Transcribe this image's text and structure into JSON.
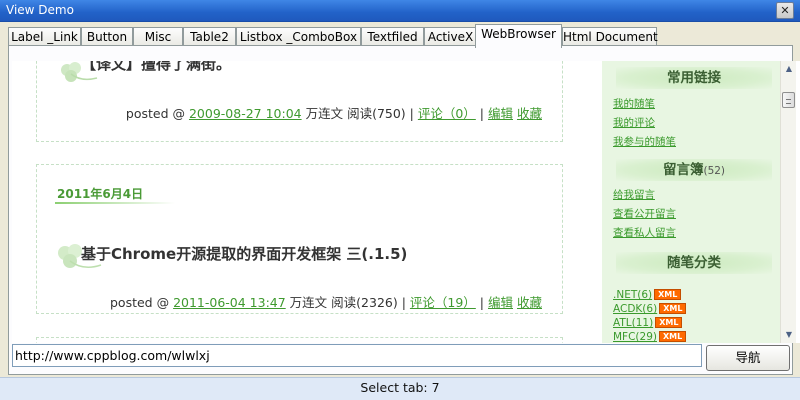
{
  "window": {
    "title": "View Demo",
    "close_glyph": "✕"
  },
  "tabs": [
    {
      "label": "Label _Link"
    },
    {
      "label": "Button"
    },
    {
      "label": "Misc"
    },
    {
      "label": "Table2"
    },
    {
      "label": "Listbox _ComboBox"
    },
    {
      "label": "Textfiled"
    },
    {
      "label": "ActiveX"
    },
    {
      "label": "WebBrowser"
    },
    {
      "label": "Html Document"
    }
  ],
  "active_tab_index": 7,
  "browser": {
    "posts": [
      {
        "title": "【译文】擅得了满街。",
        "meta_prefix": "posted @ ",
        "datetime": "2009-08-27 10:04",
        "author": " 万连文 ",
        "reads": "阅读(750)",
        "sep1": " | ",
        "comments": "评论（0）",
        "sep2": " | ",
        "edit": "编辑",
        "fav": "收藏"
      },
      {
        "date": "2011年6月4日",
        "title": "基于Chrome开源提取的界面开发框架 三(.1.5)",
        "meta_prefix": "posted @ ",
        "datetime": "2011-06-04 13:47",
        "author": " 万连文 ",
        "reads": "阅读(2326)",
        "sep1": " | ",
        "comments": "评论（19）",
        "sep2": " | ",
        "edit": "编辑",
        "fav": "收藏"
      }
    ],
    "sidebar": {
      "links_title": "常用链接",
      "links": [
        "我的随笔",
        "我的评论",
        "我参与的随笔"
      ],
      "guestbook_title": "留言簿",
      "guestbook_count": "(52)",
      "guestbook_links": [
        "给我留言",
        "查看公开留言",
        "查看私人留言"
      ],
      "categories_title": "随笔分类",
      "categories": [
        ".NET(6)",
        "ACDK(6)",
        "ATL(11)",
        "MFC(29)"
      ],
      "xml_badge": "XML"
    },
    "scroll_up_glyph": "▲",
    "scroll_down_glyph": "▼"
  },
  "url_value": "http://www.cppblog.com/wlwlxj",
  "nav_button_label": "导航",
  "status": "Select tab: 7",
  "colors": {
    "link_green": "#3f9a2f",
    "titlebar_blue": "#2262c8",
    "sidebar_bg": "#e8f6e2",
    "xml_orange": "#ff6a00"
  }
}
